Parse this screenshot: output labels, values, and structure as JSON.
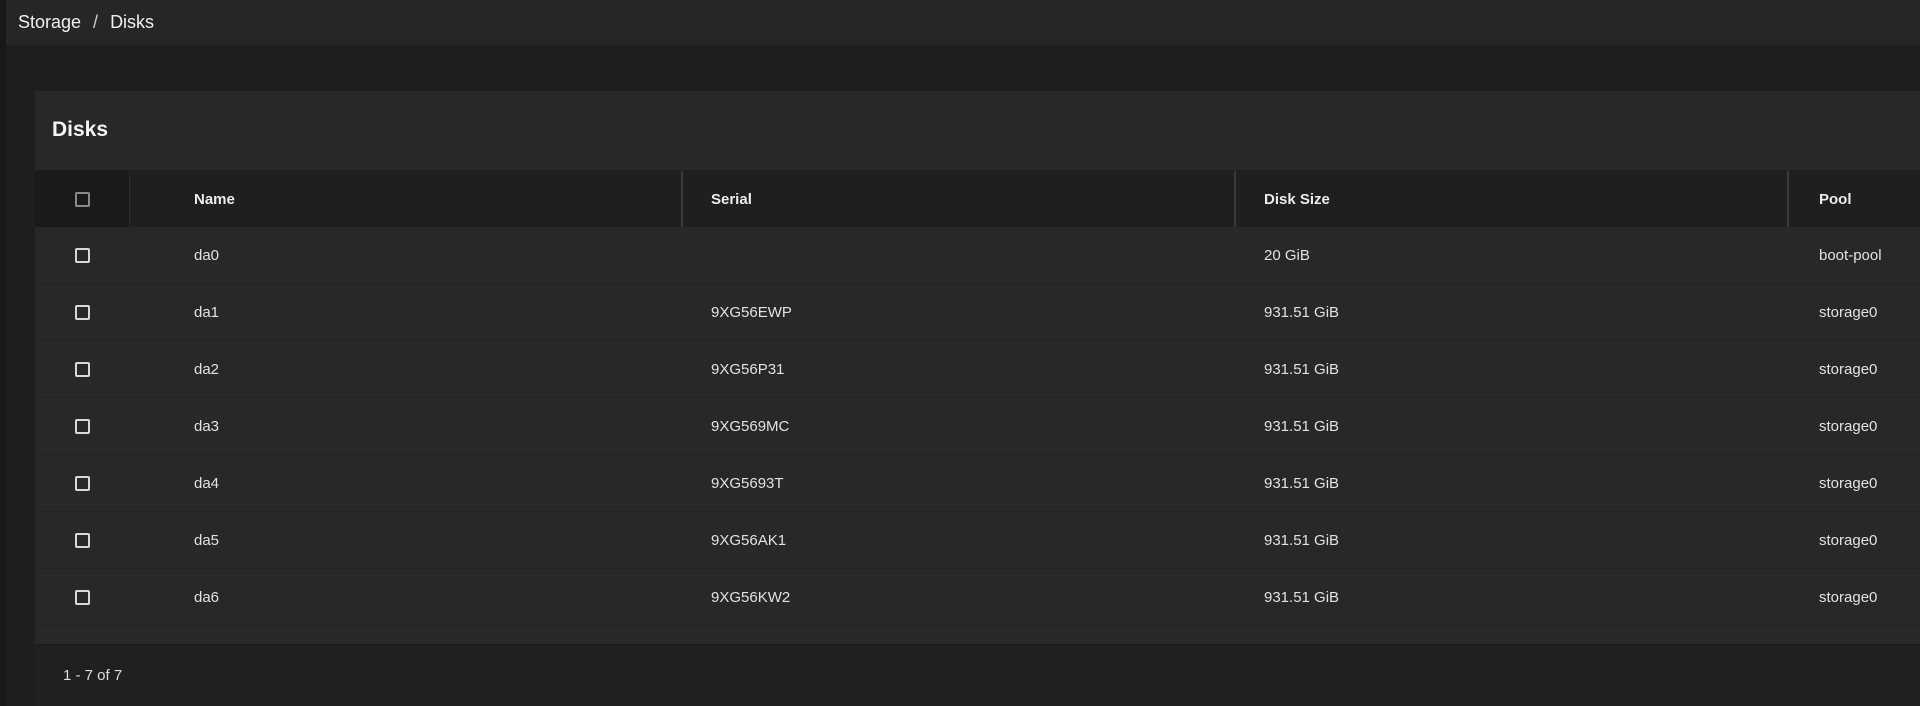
{
  "breadcrumb": {
    "root": "Storage",
    "separator": "/",
    "current": "Disks"
  },
  "card": {
    "title": "Disks"
  },
  "table": {
    "columns": [
      "Name",
      "Serial",
      "Disk Size",
      "Pool"
    ],
    "rows": [
      {
        "name": "da0",
        "serial": "",
        "size": "20 GiB",
        "pool": "boot-pool"
      },
      {
        "name": "da1",
        "serial": "9XG56EWP",
        "size": "931.51 GiB",
        "pool": "storage0"
      },
      {
        "name": "da2",
        "serial": "9XG56P31",
        "size": "931.51 GiB",
        "pool": "storage0"
      },
      {
        "name": "da3",
        "serial": "9XG569MC",
        "size": "931.51 GiB",
        "pool": "storage0"
      },
      {
        "name": "da4",
        "serial": "9XG5693T",
        "size": "931.51 GiB",
        "pool": "storage0"
      },
      {
        "name": "da5",
        "serial": "9XG56AK1",
        "size": "931.51 GiB",
        "pool": "storage0"
      },
      {
        "name": "da6",
        "serial": "9XG56KW2",
        "size": "931.51 GiB",
        "pool": "storage0"
      }
    ]
  },
  "pagination": {
    "range": "1 - 7 of 7"
  }
}
